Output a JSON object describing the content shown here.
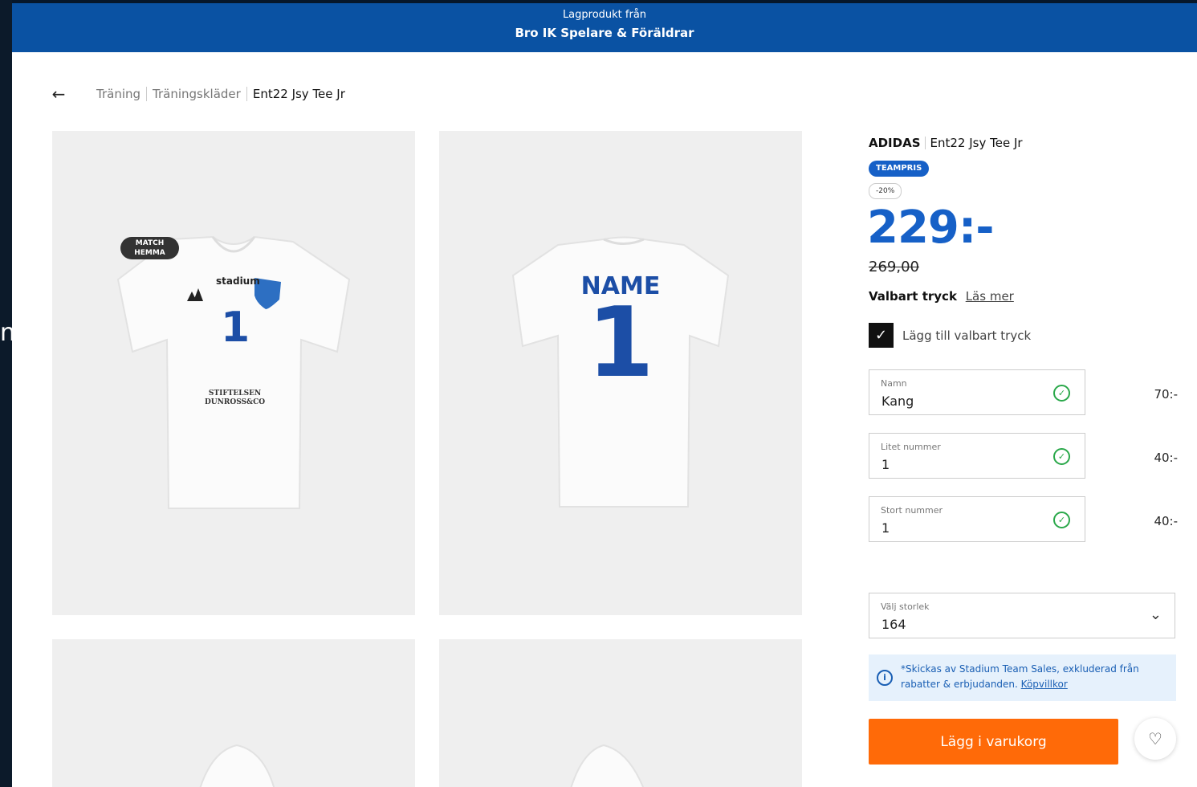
{
  "side_peek_char": "n",
  "banner": {
    "line1": "Lagprodukt från",
    "line2": "Bro IK Spelare & Föräldrar"
  },
  "breadcrumb": {
    "back_icon": "←",
    "items": [
      "Träning",
      "Träningskläder",
      "Ent22 Jsy Tee Jr"
    ]
  },
  "images": {
    "front": {
      "badge": "MATCH\nHEMMA",
      "badge_line1": "MATCH",
      "badge_line2": "HEMMA",
      "sponsor_logo": "stadium",
      "number": "1",
      "sponsor_line1": "STIFTELSEN",
      "sponsor_line2": "DUNROSS&CO"
    },
    "back": {
      "name": "NAME",
      "number": "1"
    }
  },
  "product": {
    "brand": "ADIDAS",
    "name": "Ent22 Jsy Tee Jr",
    "badge": "TEAMPRIS",
    "discount": "-20%",
    "price": "229:-",
    "old_price": "269,00",
    "print_label": "Valbart tryck",
    "print_link": "Läs mer",
    "print_checkbox_label": "Lägg till valbart tryck",
    "print_checked": true
  },
  "print_fields": [
    {
      "label": "Namn",
      "value": "Kang",
      "price": "70:-"
    },
    {
      "label": "Litet nummer",
      "value": "1",
      "price": "40:-"
    },
    {
      "label": "Stort nummer",
      "value": "1",
      "price": "40:-"
    }
  ],
  "size": {
    "label": "Välj storlek",
    "value": "164"
  },
  "info": {
    "text": "*Skickas av Stadium Team Sales, exkluderad från rabatter & erbjudanden.",
    "link": "Köpvillkor"
  },
  "actions": {
    "add_to_cart": "Lägg i varukorg"
  },
  "colors": {
    "banner": "#0a52a3",
    "accent_blue": "#1660c7",
    "cta_orange": "#ff6a08",
    "check_green": "#2aa84a",
    "info_bg": "#e6f1fc"
  }
}
